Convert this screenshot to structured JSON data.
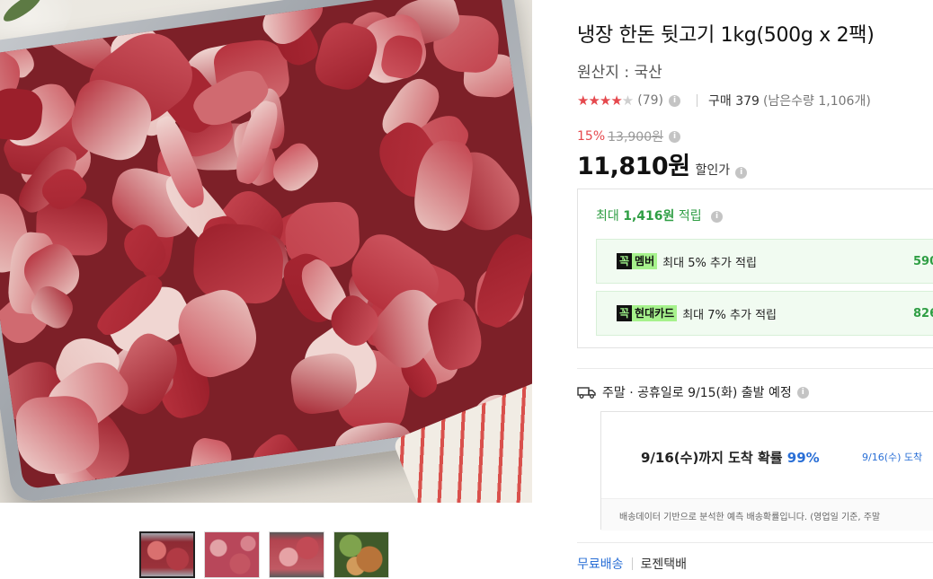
{
  "product": {
    "title": "냉장 한돈 뒷고기 1kg(500g x 2팩)",
    "origin": "원산지 : 국산",
    "rating": 4.5,
    "rating_stars_full": "★★★★",
    "rating_stars_half": "★",
    "review_count": "(79)",
    "purchase": "구매 379",
    "remaining": "(남은수량 1,106개)"
  },
  "price": {
    "discount_rate": "15%",
    "original": "13,900원",
    "sale": "11,810원",
    "sale_label": "할인가"
  },
  "points": {
    "max_prefix": "최대",
    "max_amount": "1,416원",
    "max_suffix": "적립",
    "benefits": [
      {
        "badge_k": "꼭",
        "badge_text": "멤버",
        "text": "최대 5% 추가 적립",
        "amount": "590"
      },
      {
        "badge_k": "꼭",
        "badge_text": "현대카드",
        "text": "최대 7% 추가 적립",
        "amount": "826"
      }
    ]
  },
  "shipping": {
    "schedule": "주말 · 공휴일로 9/15(화) 출발 예정",
    "arrival_main": "9/16(수)까지 도착 확률",
    "arrival_pct": "99%",
    "arrival_side": "9/16(수) 도착",
    "note": "배송데이터 기반으로 분석한 예측 배송확률입니다. (영업일 기준, 주말"
  },
  "delivery": {
    "free": "무료배송",
    "carrier": "로젠택배"
  },
  "colors": {
    "accent_red": "#e5484d",
    "point_green": "#2f9e44",
    "link_blue": "#2a6fd6"
  },
  "thumbnails": [
    "thumb-1",
    "thumb-2",
    "thumb-3",
    "thumb-4"
  ]
}
